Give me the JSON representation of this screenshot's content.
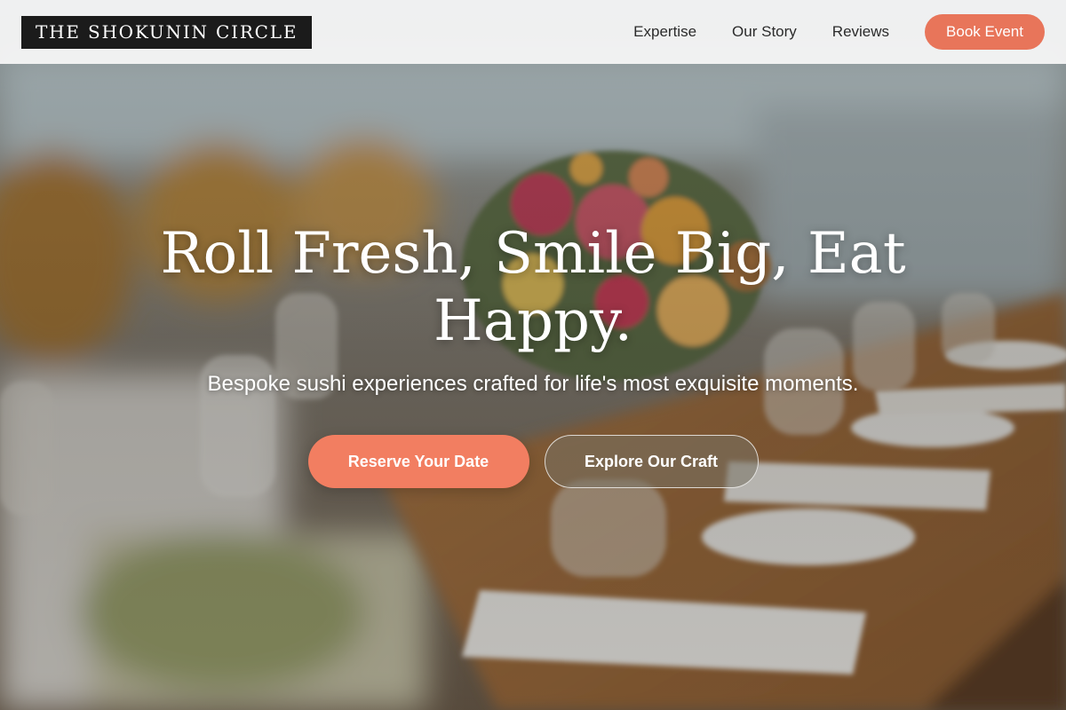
{
  "header": {
    "logo_text": "THE SHOKUNIN CIRCLE",
    "nav": [
      {
        "label": "Expertise"
      },
      {
        "label": "Our Story"
      },
      {
        "label": "Reviews"
      }
    ],
    "book_button": "Book Event"
  },
  "hero": {
    "title": "Roll Fresh, Smile Big, Eat Happy.",
    "subtitle": "Bespoke sushi experiences crafted for life's most exquisite moments.",
    "primary_cta": "Reserve Your Date",
    "secondary_cta": "Explore Our Craft"
  },
  "colors": {
    "accent": "#e8755a",
    "primary_cta": "#f27e61",
    "logo_bg": "#1b1b1b",
    "header_bg": "#f8f8f8"
  }
}
